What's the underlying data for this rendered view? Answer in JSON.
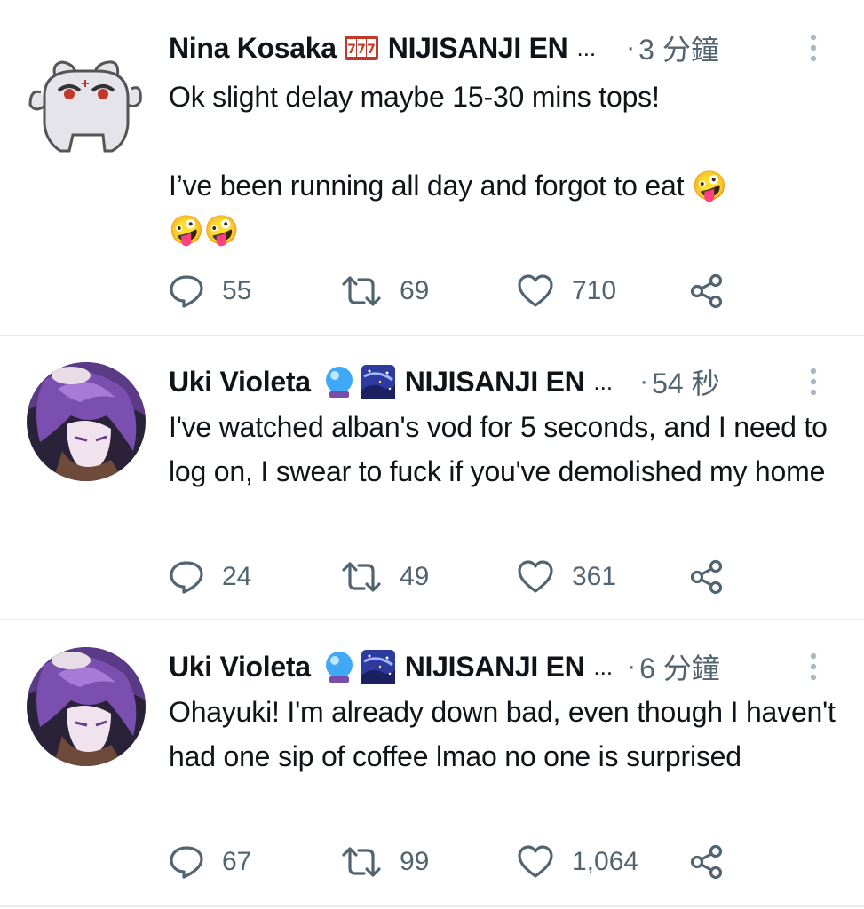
{
  "tweets": [
    {
      "author": "Nina Kosaka",
      "affiliation": "NIJISANJI EN",
      "ellipsis": "...",
      "dot": "·",
      "time": "3 分鐘",
      "text_line1": "Ok slight delay maybe 15-30 mins tops!",
      "text_line2": " I’ve been running all day and forgot to eat 🤪",
      "text_line3": "🤪🤪",
      "replies": "55",
      "retweets": "69",
      "likes": "710"
    },
    {
      "author": "Uki Violeta",
      "affiliation": "NIJISANJI EN",
      "ellipsis": "...",
      "dot": "·",
      "time": "54 秒",
      "text": "I've watched alban's vod for 5 seconds, and I need to log on, I swear to fuck if you've demolished my home",
      "replies": "24",
      "retweets": "49",
      "likes": "361"
    },
    {
      "author": "Uki Violeta",
      "affiliation": "NIJISANJI EN",
      "ellipsis": "...",
      "dot": "·",
      "time": "6 分鐘",
      "text": "Ohayuki! I'm already down bad, even though I haven't had one sip of coffee lmao no one is surprised",
      "replies": "67",
      "retweets": "99",
      "likes": "1,064"
    }
  ],
  "colors": {
    "secondary": "#536471",
    "divider": "#e6ecf0",
    "text": "#0f1419"
  },
  "icons": [
    "reply-icon",
    "retweet-icon",
    "like-icon",
    "share-icon",
    "more-icon",
    "slot-machine-emoji",
    "crystal-ball-emoji",
    "night-sky-emoji"
  ]
}
